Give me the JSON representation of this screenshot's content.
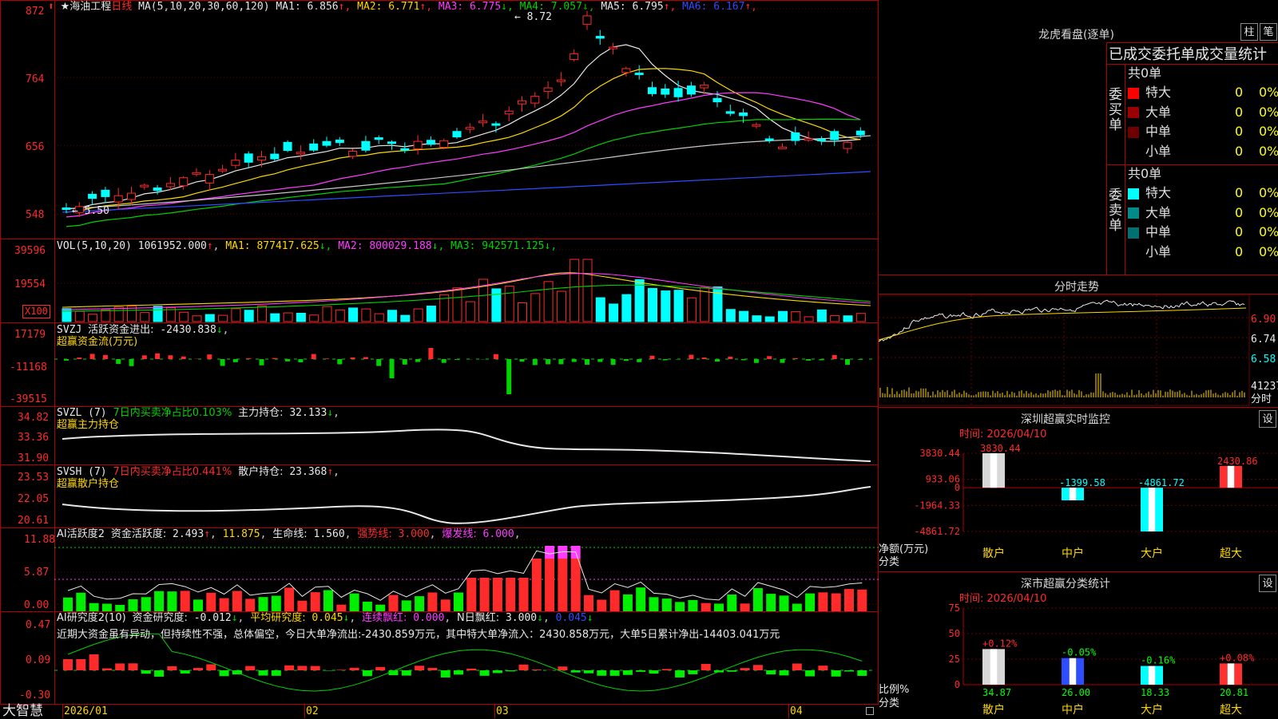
{
  "main": {
    "stock_name": "★海油工程",
    "period": "日线",
    "ma_label": "MA(5,10,20,30,60,120)",
    "ma_items": [
      {
        "label": "MA1:",
        "value": "6.856",
        "arrow": "↑",
        "color": "#e8e8e8"
      },
      {
        "label": "MA2:",
        "value": "6.771",
        "arrow": "↑",
        "color": "#ffd700"
      },
      {
        "label": "MA3:",
        "value": "6.775",
        "arrow": "↓",
        "color": "#ff3cff"
      },
      {
        "label": "MA4:",
        "value": "7.057",
        "arrow": "↓",
        "color": "#00d200"
      },
      {
        "label": "MA5:",
        "value": "6.795",
        "arrow": "↑",
        "color": "#e8e8e8"
      },
      {
        "label": "MA6:",
        "value": "6.167",
        "arrow": "↑",
        "color": "#2d4dff"
      }
    ],
    "price_ticks": [
      "872",
      "764",
      "656",
      "548"
    ],
    "high_label": "8.72",
    "low_label": "5.50"
  },
  "vol": {
    "label": "VOL(5,10,20)",
    "value": "1061952.000",
    "arrow": "↑",
    "ma_items": [
      {
        "label": "MA1:",
        "value": "877417.625",
        "arrow": "↓",
        "color": "#ffd700"
      },
      {
        "label": "MA2:",
        "value": "800029.188",
        "arrow": "↓",
        "color": "#ff3cff"
      },
      {
        "label": "MA3:",
        "value": "942571.125",
        "arrow": "↓",
        "color": "#00d200"
      }
    ],
    "ticks": [
      "39596",
      "19554"
    ],
    "unit_badge": "X100"
  },
  "svzj": {
    "name": "SVZJ",
    "label": "活跃资金进出:",
    "value": "-2430.838",
    "arrow": "↓",
    "sub": "超赢资金流(万元)",
    "ticks": [
      "17179",
      "-11168",
      "-39515"
    ]
  },
  "svzl": {
    "name": "SVZL (7)",
    "ratio_label": "7日内买卖净占比0.103%",
    "label": "主力持仓:",
    "value": "32.133",
    "arrow": "↓",
    "sub": "超赢主力持仓",
    "ticks": [
      "34.82",
      "33.36",
      "31.90"
    ]
  },
  "svsh": {
    "name": "SVSH (7)",
    "ratio_label": "7日内买卖净占比0.441%",
    "label": "散户持仓:",
    "value": "23.368",
    "arrow": "↑",
    "sub": "超赢散户持仓",
    "ticks": [
      "23.53",
      "22.05",
      "20.61"
    ]
  },
  "ai1": {
    "name": "AI活跃度2",
    "label": "资金活跃度:",
    "value": "2.493",
    "arrow": "↑",
    "v2": "11.875",
    "life_label": "生命线:",
    "life_value": "1.560",
    "strong_label": "强势线:",
    "strong_value": "3.000",
    "burst_label": "爆发线:",
    "burst_value": "6.000",
    "ticks": [
      "11.88",
      "5.87",
      "0.00"
    ]
  },
  "ai2": {
    "name": "AI研究度2(10)",
    "label": "资金研究度:",
    "value": "-0.012",
    "arrow": "↓",
    "avg_label": "平均研究度:",
    "avg_value": "0.045",
    "red_label": "连续飘红:",
    "red_value": "0.000",
    "n_label": "N日飘红:",
    "n_value": "3.000",
    "last_value": "0.045",
    "commentary": "近期大资金虽有异动，但持续性不强，总体偏空，今日大单净流出:-2430.859万元，其中特大单净流入：2430.858万元，大单5日累计净出-14403.041万元",
    "ticks": [
      "0.47",
      "0.09",
      "-0.30"
    ]
  },
  "time_axis": {
    "labels": [
      "2026/01",
      "02",
      "03",
      "04"
    ],
    "brand": "大智慧"
  },
  "right": {
    "lhb_title": "龙虎看盘(逐单)",
    "btn_bar": "柱",
    "btn_pen": "笔",
    "stats_title": "已成交委托单成交量统计",
    "buy_side_label": "委买单",
    "sell_side_label": "委卖单",
    "buy_total": "共0单",
    "sell_total": "共0单",
    "buy_rows": [
      {
        "name": "特大",
        "count": "0",
        "pct": "0%",
        "color": "#ff0000"
      },
      {
        "name": "大单",
        "count": "0",
        "pct": "0%",
        "color": "#9a0000"
      },
      {
        "name": "中单",
        "count": "0",
        "pct": "0%",
        "color": "#6e0000"
      },
      {
        "name": "小单",
        "count": "0",
        "pct": "0%",
        "color": ""
      }
    ],
    "sell_rows": [
      {
        "name": "特大",
        "count": "0",
        "pct": "0%",
        "color": "#00ffff"
      },
      {
        "name": "大单",
        "count": "0",
        "pct": "0%",
        "color": "#008a8a"
      },
      {
        "name": "中单",
        "count": "0",
        "pct": "0%",
        "color": "#007070"
      },
      {
        "name": "小单",
        "count": "0",
        "pct": "0%",
        "color": ""
      }
    ],
    "intraday_title": "分时走势",
    "intraday_ticks": [
      "6.90",
      "6.74",
      "6.58"
    ],
    "intraday_vol_value": "41237",
    "intraday_vol_unit": "分时",
    "monitor_title": "深圳超赢实时监控",
    "monitor_btn": "设",
    "monitor_time": "时间: 2026/04/10",
    "monitor_ticks": [
      "3830.44",
      "933.06",
      "0",
      "-1964.33",
      "-4861.72"
    ],
    "monitor_axis_label": "净额(万元)",
    "monitor_axis_sub": "分类",
    "classify_title": "深市超赢分类统计",
    "classify_btn": "设",
    "classify_time": "时间: 2026/04/10",
    "classify_ticks": [
      "75",
      "50",
      "25",
      "0"
    ],
    "classify_axis_label": "比例%",
    "classify_axis_sub": "分类"
  },
  "chart_data": [
    {
      "type": "bar",
      "title": "深圳超赢实时监控",
      "ylabel": "净额(万元)",
      "categories": [
        "散户",
        "中户",
        "大户",
        "超大"
      ],
      "values": [
        3830.44,
        -1399.58,
        -4861.72,
        2430.86
      ],
      "value_labels": [
        "3830.44",
        "-1399.58",
        "-4861.72",
        "2430.86"
      ],
      "ylim": [
        -4861.72,
        3830.44
      ],
      "colors": [
        "#d8d8d8",
        "#00ffff",
        "#00ffff",
        "#ff3030"
      ]
    },
    {
      "type": "bar",
      "title": "深市超赢分类统计",
      "ylabel": "比例%",
      "categories": [
        "散户",
        "中户",
        "大户",
        "超大"
      ],
      "values": [
        34.87,
        26.0,
        18.33,
        20.81
      ],
      "value_labels": [
        "34.87",
        "26.00",
        "18.33",
        "20.81"
      ],
      "change_labels": [
        "+0.12%",
        "-0.05%",
        "-0.16%",
        "+0.08%"
      ],
      "ylim": [
        0,
        75
      ],
      "colors": [
        "#d8d8d8",
        "#2d4dff",
        "#00ffff",
        "#ff3030"
      ]
    }
  ]
}
